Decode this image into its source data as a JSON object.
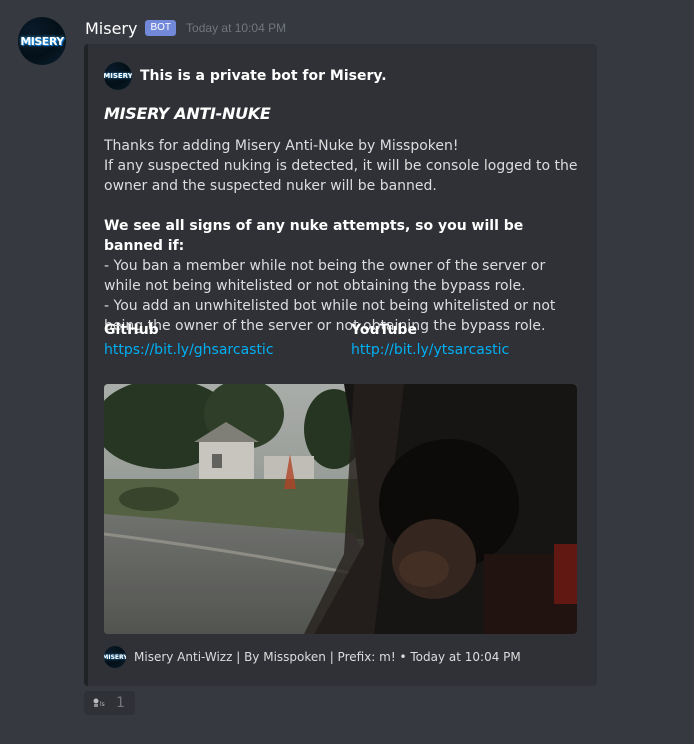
{
  "message": {
    "username": "Misery",
    "bot_tag": "BOT",
    "timestamp": "Today at 10:04 PM",
    "avatar_text": "MISERY"
  },
  "embed": {
    "author": "This is a private bot for Misery.",
    "title": "MISERY ANTI-NUKE",
    "description": {
      "line1": "Thanks for adding Misery Anti-Nuke by Misspoken!",
      "line2": "If any suspected nuking is detected, it will be console logged to the owner and the suspected nuker will be banned.",
      "bold_line": "We see all signs of any nuke attempts, so you will be banned if:",
      "rule1": "- You ban a member while not being the owner of the server or while not being whitelisted or not obtaining the bypass role.",
      "rule2": "- You add an unwhitelisted bot while not being whitelisted or not being the owner of the server or not obtaining the bypass role."
    },
    "fields": [
      {
        "name": "GitHub",
        "value": "https://bit.ly/ghsarcastic"
      },
      {
        "name": "YouTube",
        "value": "http://bit.ly/ytsarcastic"
      }
    ],
    "footer": "Misery Anti-Wizz | By Misspoken | Prefix: m! • Today at 10:04 PM",
    "colors": {
      "border": "#202225",
      "link": "#00b0f4",
      "bot_tag": "#7289da"
    }
  },
  "reaction": {
    "icon": "reaction-emoji-icon",
    "count": "1"
  }
}
